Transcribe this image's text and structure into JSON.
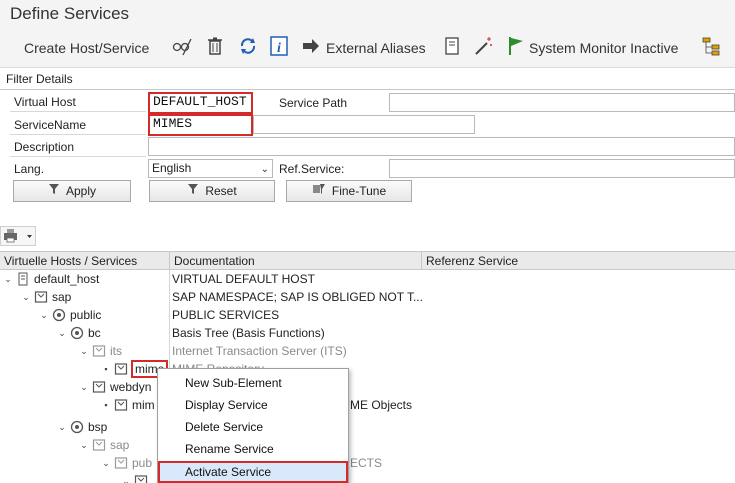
{
  "window": {
    "title": "Define Services"
  },
  "toolbar": {
    "create_label": "Create Host/Service",
    "external_aliases_label": "External Aliases",
    "system_monitor_label": "System Monitor Inactive",
    "icons": [
      "glasses-pencil-icon",
      "trash-icon",
      "refresh-icon",
      "info-icon",
      "arrow-right-icon",
      "document-icon",
      "magic-wand-icon",
      "green-flag-icon",
      "hierarchy-icon"
    ]
  },
  "filter": {
    "section_label": "Filter Details",
    "virtual_host_label": "Virtual Host",
    "virtual_host_value": "DEFAULT_HOST",
    "service_path_label": "Service Path",
    "service_path_value": "",
    "service_name_label": "ServiceName",
    "service_name_value": "MIMES",
    "description_label": "Description",
    "description_value": "",
    "lang_label": "Lang.",
    "lang_value": "English",
    "ref_service_label": "Ref.Service:",
    "ref_service_value": "",
    "apply_label": "Apply",
    "reset_label": "Reset",
    "finetune_label": "Fine-Tune"
  },
  "grid": {
    "col_hosts": "Virtuelle Hosts / Services",
    "col_doc": "Documentation",
    "col_ref": "Referenz Service",
    "rows": [
      {
        "name": "default_host",
        "doc": "VIRTUAL DEFAULT HOST"
      },
      {
        "name": "sap",
        "doc": "SAP NAMESPACE; SAP IS OBLIGED NOT T..."
      },
      {
        "name": "public",
        "doc": "PUBLIC SERVICES"
      },
      {
        "name": "bc",
        "doc": "Basis Tree (Basis Functions)"
      },
      {
        "name": "its",
        "doc": "Internet Transaction Server (ITS)"
      },
      {
        "name": "mimes",
        "doc": "MIME Repository"
      },
      {
        "name": "webdynpro",
        "doc": ""
      },
      {
        "name": "mimes",
        "doc": "Web Dynpro MIME Objects"
      },
      {
        "name": "bsp",
        "doc": ""
      },
      {
        "name": "sap",
        "doc": ""
      },
      {
        "name": "public",
        "doc": "PUBLIC SAP OBJECTS"
      },
      {
        "name": "",
        "doc": ""
      }
    ],
    "visible": {
      "r5_name": "mime",
      "r5_doc": "MIME Repository",
      "r6_name": "webdyn",
      "r7_name": "mim",
      "r7_doc": "ME Objects",
      "r10_name": "pub",
      "r10_doc": "ECTS"
    }
  },
  "context_menu": {
    "items": [
      "New Sub-Element",
      "Display Service",
      "Delete Service",
      "Rename Service",
      "Activate Service"
    ],
    "highlighted": "Activate Service"
  },
  "colors": {
    "highlight_border": "#d42a2a",
    "flag_green": "#2e8b2e",
    "info_blue": "#1e5fb3"
  }
}
